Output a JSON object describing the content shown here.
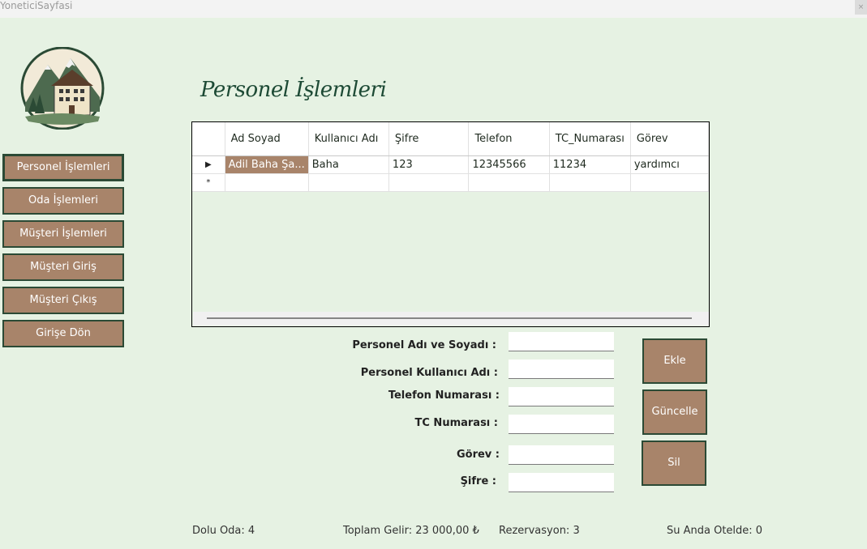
{
  "window": {
    "title": "YoneticiSayfasi",
    "close_glyph": "×"
  },
  "page_title": "Personel İşlemleri",
  "nav": [
    {
      "label": "Personel İşlemleri",
      "active": true
    },
    {
      "label": "Oda İşlemleri"
    },
    {
      "label": "Müşteri İşlemleri"
    },
    {
      "label": "Müşteri Giriş"
    },
    {
      "label": "Müşteri Çıkış"
    },
    {
      "label": "Girişe Dön"
    }
  ],
  "grid": {
    "columns": [
      "Ad Soyad",
      "Kullanıcı Adı",
      "Şifre",
      "Telefon",
      "TC_Numarası",
      "Görev"
    ],
    "rows": [
      {
        "indicator": "▶",
        "cells": [
          "Adil Baha Şa...",
          "Baha",
          "123",
          "12345566",
          "11234",
          "yardımcı"
        ]
      }
    ],
    "new_row_indicator": "*"
  },
  "form": {
    "name_label": "Personel Adı ve Soyadı :",
    "username_label": "Personel Kullanıcı Adı :",
    "phone_label": "Telefon Numarası :",
    "tc_label": "TC Numarası :",
    "role_label": "Görev :",
    "password_label": "Şifre :",
    "name_value": "",
    "username_value": "",
    "phone_value": "",
    "tc_value": "",
    "role_value": "",
    "password_value": ""
  },
  "actions": {
    "add": "Ekle",
    "update": "Güncelle",
    "delete": "Sil"
  },
  "stats": {
    "occupied": "Dolu Oda: 4",
    "revenue": "Toplam Gelir: 23 000,00 ₺",
    "reservations": "Rezervasyon: 3",
    "guests": "Su Anda Otelde: 0"
  },
  "colors": {
    "background": "#e6f2e3",
    "button": "#a8846a",
    "border": "#2b4a35",
    "title": "#1d4a35"
  }
}
